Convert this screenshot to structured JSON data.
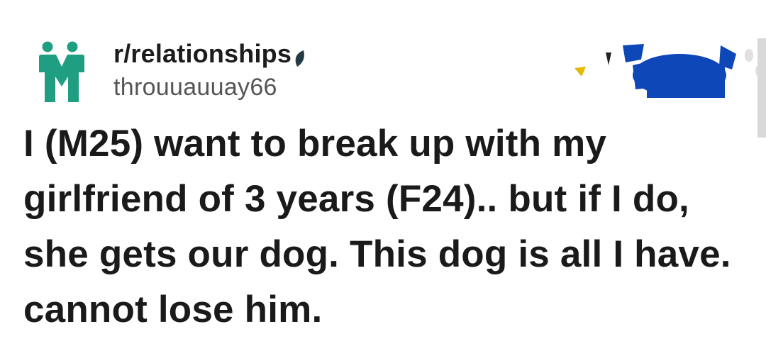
{
  "post": {
    "subreddit": "r/relationships",
    "username": "throuuauuay66",
    "title": "I (M25) want to break up with my girlfriend of 3 years (F24).. but if I do, she gets our dog. This dog is all I have. cannot lose him."
  },
  "icons": {
    "subreddit_icon": "two-people-icon",
    "flair_icon": "leaf-icon",
    "awards": "award-icons"
  },
  "colors": {
    "subreddit_icon": "#1f9e82",
    "leaf": "#243b43",
    "award_blue": "#0d47b8",
    "award_gold": "#e6b800"
  }
}
